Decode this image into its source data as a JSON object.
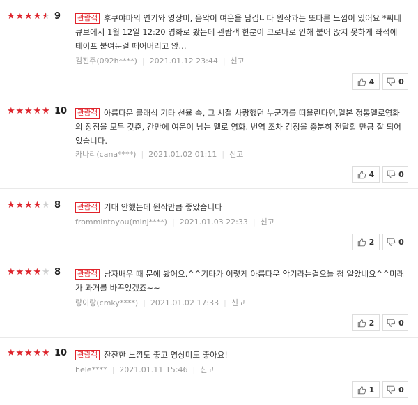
{
  "badge_label": "관람객",
  "report_label": "신고",
  "colors": {
    "accent": "#e0232b",
    "star_empty": "#cfcfcf"
  },
  "icons": {
    "like": "thumbs-up-icon",
    "dislike": "thumbs-down-icon",
    "star": "star-icon"
  },
  "reviews": [
    {
      "score": "9",
      "stars": 4.5,
      "text": "후쿠야마의 연기와 영상미, 음악이 여운을 남깁니다 원작과는 또다른 느낌이 있어요 *씨네큐브에서 1월 12일 12:20 영화로 봤는데 관람객 한분이 코로나로 인해 붙어 앉지 못하게 좌석에 테이프 붙여둔걸 떼어버리고 앉...",
      "author": "김진주(092h****)",
      "date": "2021.01.12 23:44",
      "likes": "4",
      "dislikes": "0"
    },
    {
      "score": "10",
      "stars": 5,
      "text": "아름다운 클래식 기타 선율 속, 그 시절 사랑했던 누군가를 떠올린다면,일본 정통멜로영화의 장점을 모두 갖춘, 간만에 여운이 남는 멜로 영화. 번역 조차 감정을 충분히 전달할 만큼 잘 되어있습니다.",
      "author": "카나리(cana****)",
      "date": "2021.01.02 01:11",
      "likes": "4",
      "dislikes": "0"
    },
    {
      "score": "8",
      "stars": 4,
      "text": "기대 안했는데 원작만큼 좋았습니다",
      "author": "frommintoyou(minj****)",
      "date": "2021.01.03 22:33",
      "likes": "2",
      "dislikes": "0"
    },
    {
      "score": "8",
      "stars": 4,
      "text": "남자배우 때 문에 봤어요.^^기타가 이렇게 아름다운 악기라는걸오늘 첨 알았네요^^미래가 과거를 바꾸었겠죠~~",
      "author": "랑이랑(cmky****)",
      "date": "2021.01.02 17:33",
      "likes": "2",
      "dislikes": "0"
    },
    {
      "score": "10",
      "stars": 5,
      "text": "잔잔한 느낌도 좋고 영상미도 좋아요!",
      "author": "hele****",
      "date": "2021.01.11 15:46",
      "likes": "1",
      "dislikes": "0"
    }
  ]
}
